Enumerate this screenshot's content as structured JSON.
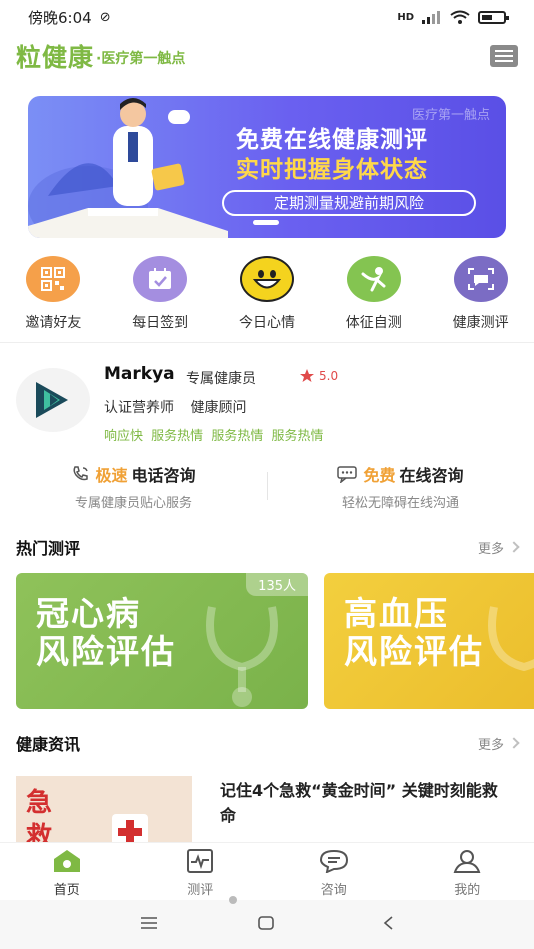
{
  "status_bar": {
    "time": "傍晚6:04",
    "network": "HD"
  },
  "header": {
    "brand": "粒健康",
    "slogan": "·医疗第一触点",
    "message_icon": "message-icon"
  },
  "banner": {
    "corner_text": "医疗第一触点",
    "title": "免费在线健康测评",
    "subtitle": "实时把握身体状态",
    "pill_text": "定期测量规避前期风险",
    "colors": {
      "start": "#7b8ff5",
      "end": "#5a4fe6",
      "accent": "#ffd84a"
    }
  },
  "quick_actions": [
    {
      "label": "邀请好友",
      "icon": "qr-code-icon",
      "color": "#f5a04a"
    },
    {
      "label": "每日签到",
      "icon": "calendar-check-icon",
      "color": "#a48ee0"
    },
    {
      "label": "今日心情",
      "icon": "smiley-face-icon",
      "color": "#f4d31e"
    },
    {
      "label": "体征自测",
      "icon": "person-figure-icon",
      "color": "#84c451"
    },
    {
      "label": "健康测评",
      "icon": "chat-scan-icon",
      "color": "#7b6cc4"
    }
  ],
  "advisor": {
    "name": "Markya",
    "role": "专属健康员",
    "rating": "5.0",
    "certs": [
      "认证营养师",
      "健康顾问"
    ],
    "tags": [
      "响应快",
      "服务热情",
      "服务热情",
      "服务热情"
    ]
  },
  "consult": {
    "phone": {
      "highlight": "极速",
      "title": "电话咨询",
      "subtitle": "专属健康员贴心服务"
    },
    "online": {
      "highlight": "免费",
      "title": "在线咨询",
      "subtitle": "轻松无障碍在线沟通"
    }
  },
  "hot_tests": {
    "title": "热门测评",
    "more": "更多",
    "cards": [
      {
        "line1": "冠心病",
        "line2": "风险评估",
        "count": "135人",
        "color": "#86bc50"
      },
      {
        "line1": "高血压",
        "line2": "风险评估",
        "count": "",
        "color": "#f0c838"
      }
    ]
  },
  "health_news": {
    "title": "健康资讯",
    "more": "更多",
    "items": [
      {
        "title": "记住4个急救“黄金时间” 关键时刻能救命",
        "thumb_text": "急救"
      }
    ]
  },
  "tabbar": {
    "tabs": [
      {
        "label": "首页",
        "icon": "home-icon",
        "active": true
      },
      {
        "label": "测评",
        "icon": "report-icon",
        "active": false
      },
      {
        "label": "咨询",
        "icon": "chat-bubble-icon",
        "active": false
      },
      {
        "label": "我的",
        "icon": "user-icon",
        "active": false
      }
    ],
    "active_color": "#7fb944"
  }
}
